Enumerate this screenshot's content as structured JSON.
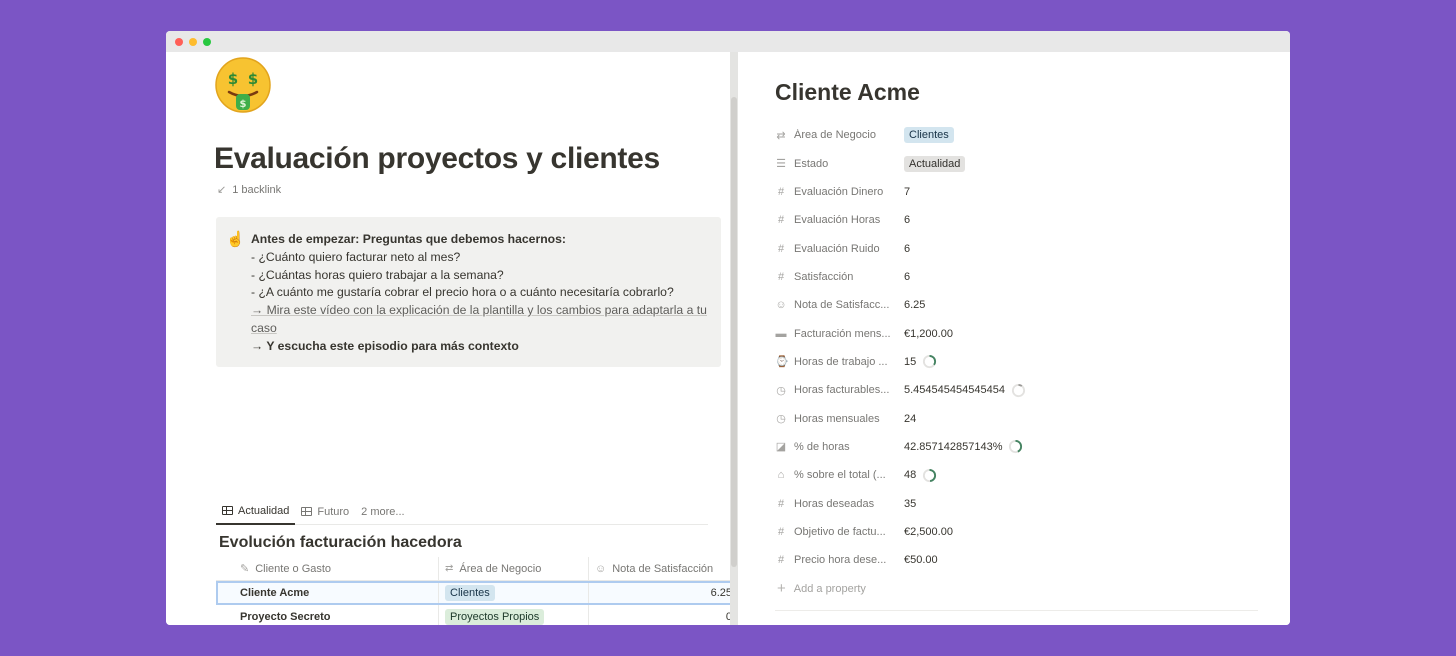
{
  "left": {
    "page_title": "Evaluación proyectos y clientes",
    "backlink": "1 backlink",
    "callout": {
      "heading": "Antes de empezar: Preguntas que debemos hacernos:",
      "line1": "- ¿Cuánto quiero facturar neto al mes?",
      "line2": "- ¿Cuántas horas quiero trabajar a la semana?",
      "line3": "- ¿A cuánto me gustaría cobrar el precio hora o a cuánto necesitaría cobrarlo?",
      "link1": "→ Mira este vídeo con la explicación de la plantilla y los cambios para adaptarla a tu caso",
      "link2": "→ Y escucha este episodio para más contexto"
    },
    "tabs": [
      "Actualidad",
      "Futuro",
      "2 more..."
    ],
    "db_title": "Evolución facturación hacedora",
    "table": {
      "headers": [
        "Cliente o Gasto",
        "Área de Negocio",
        "Nota de Satisfacción"
      ],
      "rows": [
        {
          "name": "Cliente Acme",
          "area": "Clientes",
          "nota": "6.25"
        },
        {
          "name": "Proyecto Secreto",
          "area": "Proyectos Propios",
          "nota": "0"
        }
      ]
    }
  },
  "right": {
    "title": "Cliente Acme",
    "properties": [
      {
        "icon": "relation-icon",
        "name": "Área de Negocio",
        "value": "Clientes",
        "kind": "tag-blue"
      },
      {
        "icon": "list-icon",
        "name": "Estado",
        "value": "Actualidad",
        "kind": "tag-gray"
      },
      {
        "icon": "hash-icon",
        "name": "Evaluación Dinero",
        "value": "7",
        "kind": "text"
      },
      {
        "icon": "hash-icon",
        "name": "Evaluación Horas",
        "value": "6",
        "kind": "text"
      },
      {
        "icon": "hash-icon",
        "name": "Evaluación Ruido",
        "value": "6",
        "kind": "text"
      },
      {
        "icon": "hash-icon",
        "name": "Satisfacción",
        "value": "6",
        "kind": "text"
      },
      {
        "icon": "face-icon",
        "name": "Nota de Satisfacc...",
        "value": "6.25",
        "kind": "text"
      },
      {
        "icon": "cash-icon",
        "name": "Facturación mens...",
        "value": "€1,200.00",
        "kind": "text"
      },
      {
        "icon": "watch-icon",
        "name": "Horas de trabajo ...",
        "value": "15",
        "kind": "ring",
        "ring_color": "#448361",
        "ring_fraction": 0.35
      },
      {
        "icon": "clock-icon",
        "name": "Horas facturables...",
        "value": "5.454545454545454",
        "kind": "ring",
        "ring_color": "#9b9a97",
        "ring_fraction": 0.1
      },
      {
        "icon": "clock-icon",
        "name": "Horas mensuales",
        "value": "24",
        "kind": "text"
      },
      {
        "icon": "chart-icon",
        "name": "% de horas",
        "value": "42.857142857143%",
        "kind": "ring",
        "ring_color": "#448361",
        "ring_fraction": 0.43
      },
      {
        "icon": "bank-icon",
        "name": "% sobre el total (...",
        "value": "48",
        "kind": "ring",
        "ring_color": "#448361",
        "ring_fraction": 0.48
      },
      {
        "icon": "hash-icon",
        "name": "Horas deseadas",
        "value": "35",
        "kind": "text"
      },
      {
        "icon": "hash-icon",
        "name": "Objetivo de factu...",
        "value": "€2,500.00",
        "kind": "text"
      },
      {
        "icon": "hash-icon",
        "name": "Precio hora dese...",
        "value": "€50.00",
        "kind": "text"
      }
    ],
    "add_property": "Add a property"
  }
}
